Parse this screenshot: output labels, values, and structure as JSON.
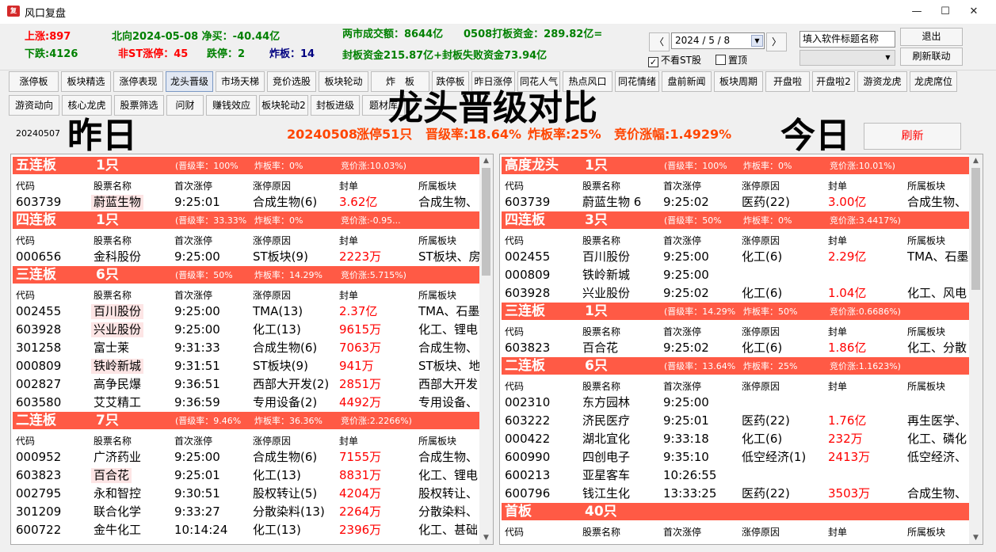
{
  "window": {
    "icon_text": "复",
    "title": "风口复盘",
    "min": "—",
    "max": "☐",
    "close": "✕"
  },
  "info": {
    "up_limit": "上涨:897",
    "down_limit": "下跌:4126",
    "northbound": "北向2024-05-08 净买：-40.44亿",
    "non_st_limit_up": "非ST涨停：45",
    "limit_down": "跌停：2",
    "broken_board": "炸板：14",
    "turnover": "两市成交额：8644亿",
    "board_funds": "0508打板资金：289.82亿=",
    "seal_funds": "封板资金215.87亿+封板失败资金73.94亿"
  },
  "datebar": {
    "prev": "〈",
    "next": "〉",
    "date": "2024 / 5 / 8",
    "no_st_label": "不看ST股",
    "no_st_checked": true,
    "pin_label": "置顶",
    "pin_checked": false,
    "title_input": "填入软件标题名称",
    "exit_label": "退出",
    "refresh_link_label": "刷新联动"
  },
  "tabs_row1": [
    "涨停板",
    "板块精选",
    "涨停表现",
    "龙头晋级",
    "市场天梯",
    "竞价选股",
    "板块轮动",
    "炸　板",
    "跌停板",
    "昨日涨停",
    "同花人气",
    "热点风口",
    "同花情绪",
    "盘前新闻",
    "板块周期",
    "开盘啦",
    "开盘啦2",
    "游资龙虎",
    "龙虎席位"
  ],
  "tabs_row2": [
    "游资动向",
    "核心龙虎",
    "股票筛选",
    "问财",
    "赚钱效应",
    "板块轮动2",
    "封板进级",
    "题材库"
  ],
  "active_tab": "龙头晋级",
  "captions": {
    "main": "龙头晋级对比",
    "yesterday": "昨日",
    "today": "今日",
    "small_date": "20240507"
  },
  "summary": {
    "date": "20240508",
    "limit_up": "涨停51只",
    "promotion_rate": "晋级率:18.64%",
    "broken_rate": "炸板率:25%",
    "auction_rise": "竞价涨幅:1.4929%"
  },
  "refresh_label": "刷新",
  "columns": [
    "代码",
    "股票名称",
    "首次涨停",
    "涨停原因",
    "封单",
    "所属板块"
  ],
  "left_panel": {
    "sections": [
      {
        "name": "五连板",
        "count": "1只",
        "promo": "(晋级率：100%",
        "broken": "炸板率：0%",
        "auction": "竞价涨:10.03%)",
        "rows": [
          {
            "code": "603739",
            "name": "蔚蓝生物",
            "hl": true,
            "time": "9:25:01",
            "reason": "合成生物(6)",
            "seal": "3.62亿",
            "sector": "合成生物、"
          }
        ]
      },
      {
        "name": "四连板",
        "count": "1只",
        "promo": "(晋级率：33.33%",
        "broken": "炸板率：0%",
        "auction": "竞价涨:-0.95...",
        "rows": [
          {
            "code": "000656",
            "name": "金科股份",
            "hl": false,
            "time": "9:25:00",
            "reason": "ST板块(9)",
            "seal": "2223万",
            "sector": "ST板块、房"
          }
        ]
      },
      {
        "name": "三连板",
        "count": "6只",
        "promo": "(晋级率：50%",
        "broken": "炸板率：14.29%",
        "auction": "竞价涨:5.715%)",
        "rows": [
          {
            "code": "002455",
            "name": "百川股份",
            "hl": true,
            "time": "9:25:00",
            "reason": "TMA(13)",
            "seal": "2.37亿",
            "sector": "TMA、石墨"
          },
          {
            "code": "603928",
            "name": "兴业股份",
            "hl": true,
            "time": "9:25:00",
            "reason": "化工(13)",
            "seal": "9615万",
            "sector": "化工、锂电"
          },
          {
            "code": "301258",
            "name": "富士莱",
            "hl": false,
            "time": "9:31:33",
            "reason": "合成生物(6)",
            "seal": "7063万",
            "sector": "合成生物、"
          },
          {
            "code": "000809",
            "name": "铁岭新城",
            "hl": true,
            "time": "9:31:51",
            "reason": "ST板块(9)",
            "seal": "941万",
            "sector": "ST板块、地"
          },
          {
            "code": "002827",
            "name": "高争民爆",
            "hl": false,
            "time": "9:36:51",
            "reason": "西部大开发(2)",
            "seal": "2851万",
            "sector": "西部大开发"
          },
          {
            "code": "603580",
            "name": "艾艾精工",
            "hl": false,
            "time": "9:36:59",
            "reason": "专用设备(2)",
            "seal": "4492万",
            "sector": "专用设备、"
          }
        ]
      },
      {
        "name": "二连板",
        "count": "7只",
        "promo": "(晋级率：9.46%",
        "broken": "炸板率：36.36%",
        "auction": "竞价涨:2.2266%)",
        "rows": [
          {
            "code": "000952",
            "name": "广济药业",
            "hl": false,
            "time": "9:25:00",
            "reason": "合成生物(6)",
            "seal": "7155万",
            "sector": "合成生物、"
          },
          {
            "code": "603823",
            "name": "百合花",
            "hl": true,
            "time": "9:25:01",
            "reason": "化工(13)",
            "seal": "8831万",
            "sector": "化工、锂电"
          },
          {
            "code": "002795",
            "name": "永和智控",
            "hl": false,
            "time": "9:30:51",
            "reason": "股权转让(5)",
            "seal": "4204万",
            "sector": "股权转让、"
          },
          {
            "code": "301209",
            "name": "联合化学",
            "hl": false,
            "time": "9:33:27",
            "reason": "分散染料(13)",
            "seal": "2264万",
            "sector": "分散染料、"
          },
          {
            "code": "600722",
            "name": "金牛化工",
            "hl": false,
            "time": "10:14:24",
            "reason": "化工(13)",
            "seal": "2396万",
            "sector": "化工、甚础"
          }
        ]
      }
    ]
  },
  "right_panel": {
    "sections": [
      {
        "name": "高度龙头",
        "count": "1只",
        "promo": "(晋级率：100%",
        "broken": "炸板率：0%",
        "auction": "竞价涨:10.01%)",
        "rows": [
          {
            "code": "603739",
            "name": "蔚蓝生物 6",
            "hl": false,
            "time": "9:25:02",
            "reason": "医药(22)",
            "seal": "3.00亿",
            "sector": "合成生物、"
          }
        ]
      },
      {
        "name": "四连板",
        "count": "3只",
        "promo": "(晋级率：50%",
        "broken": "炸板率：0%",
        "auction": "竞价涨:3.4417%)",
        "rows": [
          {
            "code": "002455",
            "name": "百川股份",
            "hl": false,
            "time": "9:25:00",
            "reason": "化工(6)",
            "seal": "2.29亿",
            "sector": "TMA、石墨"
          },
          {
            "code": "000809",
            "name": "铁岭新城",
            "hl": false,
            "time": "9:25:00",
            "reason": "",
            "seal": "",
            "sector": ""
          },
          {
            "code": "603928",
            "name": "兴业股份",
            "hl": false,
            "time": "9:25:02",
            "reason": "化工(6)",
            "seal": "1.04亿",
            "sector": "化工、风电"
          }
        ]
      },
      {
        "name": "三连板",
        "count": "1只",
        "promo": "(晋级率：14.29%",
        "broken": "炸板率：50%",
        "auction": "竞价涨:0.6686%)",
        "rows": [
          {
            "code": "603823",
            "name": "百合花",
            "hl": false,
            "time": "9:25:02",
            "reason": "化工(6)",
            "seal": "1.86亿",
            "sector": "化工、分散"
          }
        ]
      },
      {
        "name": "二连板",
        "count": "6只",
        "promo": "(晋级率：13.64%",
        "broken": "炸板率：25%",
        "auction": "竞价涨:1.1623%)",
        "rows": [
          {
            "code": "002310",
            "name": "东方园林",
            "hl": false,
            "time": "9:25:00",
            "reason": "",
            "seal": "",
            "sector": ""
          },
          {
            "code": "603222",
            "name": "济民医疗",
            "hl": false,
            "time": "9:25:01",
            "reason": "医药(22)",
            "seal": "1.76亿",
            "sector": "再生医学、"
          },
          {
            "code": "000422",
            "name": "湖北宜化",
            "hl": false,
            "time": "9:33:18",
            "reason": "化工(6)",
            "seal": "232万",
            "sector": "化工、磷化"
          },
          {
            "code": "600990",
            "name": "四创电子",
            "hl": false,
            "time": "9:35:10",
            "reason": "低空经济(1)",
            "seal": "2413万",
            "sector": "低空经济、"
          },
          {
            "code": "600213",
            "name": "亚星客车",
            "hl": false,
            "time": "10:26:55",
            "reason": "",
            "seal": "",
            "sector": ""
          },
          {
            "code": "600796",
            "name": "钱江生化",
            "hl": false,
            "time": "13:33:25",
            "reason": "医药(22)",
            "seal": "3503万",
            "sector": "合成生物、"
          }
        ]
      },
      {
        "name": "首板",
        "count": "40只",
        "promo": "",
        "broken": "",
        "auction": "",
        "rows": []
      }
    ]
  }
}
